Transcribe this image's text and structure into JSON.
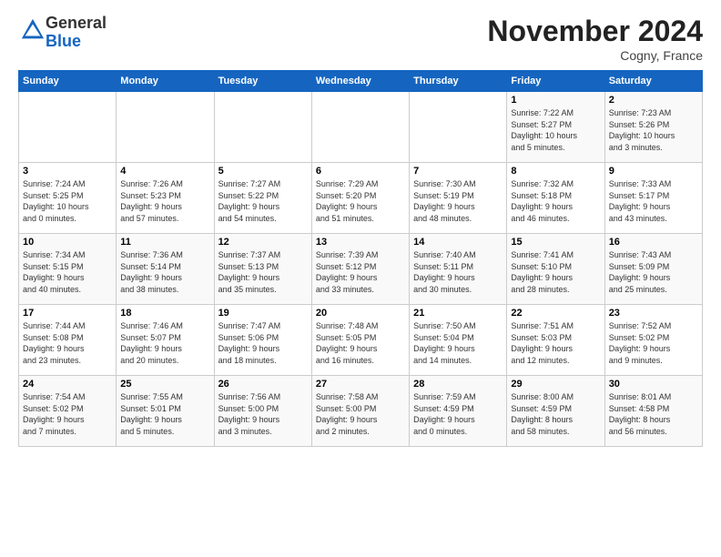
{
  "logo": {
    "general": "General",
    "blue": "Blue"
  },
  "title": "November 2024",
  "location": "Cogny, France",
  "days_of_week": [
    "Sunday",
    "Monday",
    "Tuesday",
    "Wednesday",
    "Thursday",
    "Friday",
    "Saturday"
  ],
  "weeks": [
    [
      {
        "day": "",
        "info": ""
      },
      {
        "day": "",
        "info": ""
      },
      {
        "day": "",
        "info": ""
      },
      {
        "day": "",
        "info": ""
      },
      {
        "day": "",
        "info": ""
      },
      {
        "day": "1",
        "info": "Sunrise: 7:22 AM\nSunset: 5:27 PM\nDaylight: 10 hours\nand 5 minutes."
      },
      {
        "day": "2",
        "info": "Sunrise: 7:23 AM\nSunset: 5:26 PM\nDaylight: 10 hours\nand 3 minutes."
      }
    ],
    [
      {
        "day": "3",
        "info": "Sunrise: 7:24 AM\nSunset: 5:25 PM\nDaylight: 10 hours\nand 0 minutes."
      },
      {
        "day": "4",
        "info": "Sunrise: 7:26 AM\nSunset: 5:23 PM\nDaylight: 9 hours\nand 57 minutes."
      },
      {
        "day": "5",
        "info": "Sunrise: 7:27 AM\nSunset: 5:22 PM\nDaylight: 9 hours\nand 54 minutes."
      },
      {
        "day": "6",
        "info": "Sunrise: 7:29 AM\nSunset: 5:20 PM\nDaylight: 9 hours\nand 51 minutes."
      },
      {
        "day": "7",
        "info": "Sunrise: 7:30 AM\nSunset: 5:19 PM\nDaylight: 9 hours\nand 48 minutes."
      },
      {
        "day": "8",
        "info": "Sunrise: 7:32 AM\nSunset: 5:18 PM\nDaylight: 9 hours\nand 46 minutes."
      },
      {
        "day": "9",
        "info": "Sunrise: 7:33 AM\nSunset: 5:17 PM\nDaylight: 9 hours\nand 43 minutes."
      }
    ],
    [
      {
        "day": "10",
        "info": "Sunrise: 7:34 AM\nSunset: 5:15 PM\nDaylight: 9 hours\nand 40 minutes."
      },
      {
        "day": "11",
        "info": "Sunrise: 7:36 AM\nSunset: 5:14 PM\nDaylight: 9 hours\nand 38 minutes."
      },
      {
        "day": "12",
        "info": "Sunrise: 7:37 AM\nSunset: 5:13 PM\nDaylight: 9 hours\nand 35 minutes."
      },
      {
        "day": "13",
        "info": "Sunrise: 7:39 AM\nSunset: 5:12 PM\nDaylight: 9 hours\nand 33 minutes."
      },
      {
        "day": "14",
        "info": "Sunrise: 7:40 AM\nSunset: 5:11 PM\nDaylight: 9 hours\nand 30 minutes."
      },
      {
        "day": "15",
        "info": "Sunrise: 7:41 AM\nSunset: 5:10 PM\nDaylight: 9 hours\nand 28 minutes."
      },
      {
        "day": "16",
        "info": "Sunrise: 7:43 AM\nSunset: 5:09 PM\nDaylight: 9 hours\nand 25 minutes."
      }
    ],
    [
      {
        "day": "17",
        "info": "Sunrise: 7:44 AM\nSunset: 5:08 PM\nDaylight: 9 hours\nand 23 minutes."
      },
      {
        "day": "18",
        "info": "Sunrise: 7:46 AM\nSunset: 5:07 PM\nDaylight: 9 hours\nand 20 minutes."
      },
      {
        "day": "19",
        "info": "Sunrise: 7:47 AM\nSunset: 5:06 PM\nDaylight: 9 hours\nand 18 minutes."
      },
      {
        "day": "20",
        "info": "Sunrise: 7:48 AM\nSunset: 5:05 PM\nDaylight: 9 hours\nand 16 minutes."
      },
      {
        "day": "21",
        "info": "Sunrise: 7:50 AM\nSunset: 5:04 PM\nDaylight: 9 hours\nand 14 minutes."
      },
      {
        "day": "22",
        "info": "Sunrise: 7:51 AM\nSunset: 5:03 PM\nDaylight: 9 hours\nand 12 minutes."
      },
      {
        "day": "23",
        "info": "Sunrise: 7:52 AM\nSunset: 5:02 PM\nDaylight: 9 hours\nand 9 minutes."
      }
    ],
    [
      {
        "day": "24",
        "info": "Sunrise: 7:54 AM\nSunset: 5:02 PM\nDaylight: 9 hours\nand 7 minutes."
      },
      {
        "day": "25",
        "info": "Sunrise: 7:55 AM\nSunset: 5:01 PM\nDaylight: 9 hours\nand 5 minutes."
      },
      {
        "day": "26",
        "info": "Sunrise: 7:56 AM\nSunset: 5:00 PM\nDaylight: 9 hours\nand 3 minutes."
      },
      {
        "day": "27",
        "info": "Sunrise: 7:58 AM\nSunset: 5:00 PM\nDaylight: 9 hours\nand 2 minutes."
      },
      {
        "day": "28",
        "info": "Sunrise: 7:59 AM\nSunset: 4:59 PM\nDaylight: 9 hours\nand 0 minutes."
      },
      {
        "day": "29",
        "info": "Sunrise: 8:00 AM\nSunset: 4:59 PM\nDaylight: 8 hours\nand 58 minutes."
      },
      {
        "day": "30",
        "info": "Sunrise: 8:01 AM\nSunset: 4:58 PM\nDaylight: 8 hours\nand 56 minutes."
      }
    ]
  ]
}
